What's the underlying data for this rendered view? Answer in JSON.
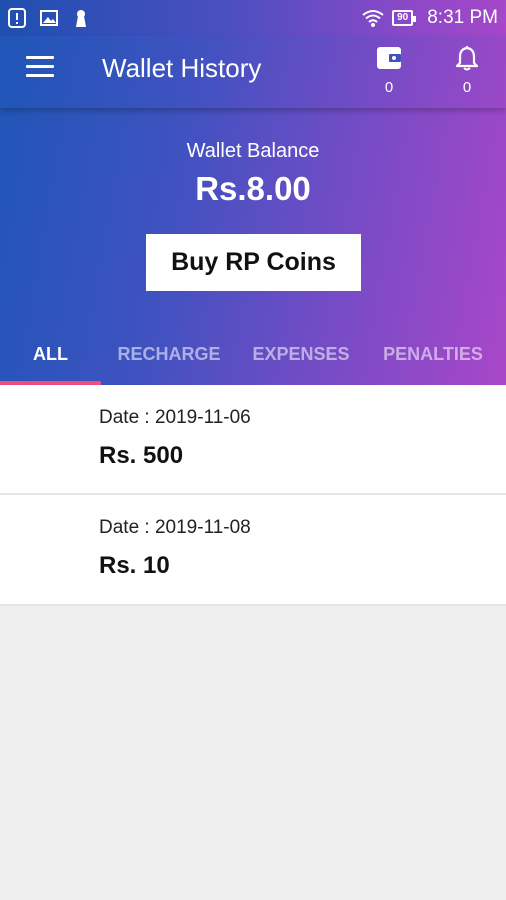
{
  "status_bar": {
    "battery": "90",
    "time": "8:31 PM",
    "icons": [
      "alert-icon",
      "image-icon",
      "keyhole-icon",
      "wifi-icon",
      "battery-icon"
    ]
  },
  "toolbar": {
    "title": "Wallet History",
    "wallet_count": "0",
    "notification_count": "0"
  },
  "balance": {
    "label": "Wallet Balance",
    "amount": "Rs.8.00",
    "buy_label": "Buy RP Coins"
  },
  "tabs": [
    {
      "label": "ALL",
      "active": true
    },
    {
      "label": "RECHARGE",
      "active": false
    },
    {
      "label": "EXPENSES",
      "active": false
    },
    {
      "label": "PENALTIES",
      "active": false
    }
  ],
  "transactions": [
    {
      "date": "Date : 2019-11-06",
      "amount": "Rs. 500"
    },
    {
      "date": "Date : 2019-11-08",
      "amount": "Rs. 10"
    }
  ],
  "colors": {
    "gradient_start": "#1f56b8",
    "gradient_end": "#a847c8",
    "tab_indicator": "#ec4f7e"
  }
}
